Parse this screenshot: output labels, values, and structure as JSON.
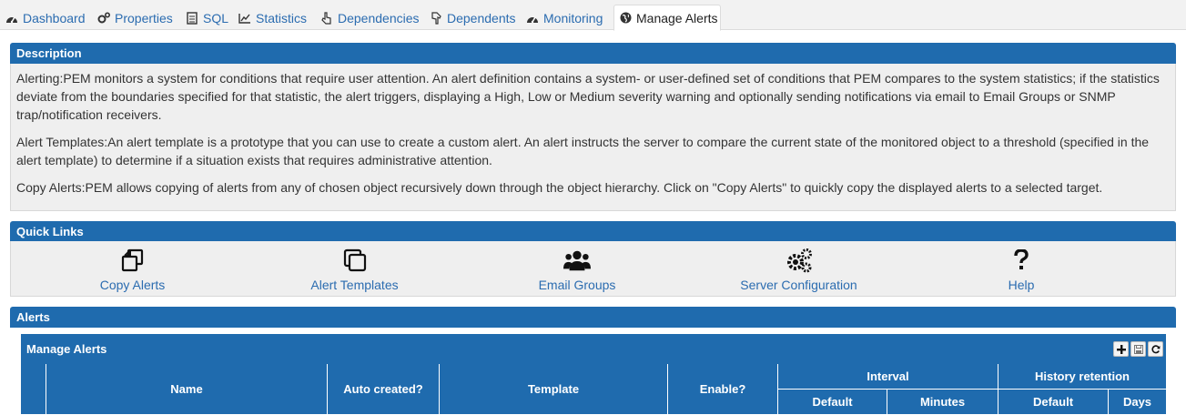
{
  "tabs": [
    {
      "label": "Dashboard",
      "icon": "dashboard-icon"
    },
    {
      "label": "Properties",
      "icon": "gears-icon"
    },
    {
      "label": "SQL",
      "icon": "file-icon"
    },
    {
      "label": "Statistics",
      "icon": "line-chart-icon"
    },
    {
      "label": "Dependencies",
      "icon": "hand-pointer-icon"
    },
    {
      "label": "Dependents",
      "icon": "hand-icon"
    },
    {
      "label": "Monitoring",
      "icon": "dashboard-icon"
    },
    {
      "label": "Manage Alerts",
      "icon": "globe-icon",
      "active": true
    }
  ],
  "description": {
    "title": "Description",
    "paragraphs": [
      "Alerting:PEM monitors a system for conditions that require user attention. An alert definition contains a system- or user-defined set of conditions that PEM compares to the system statistics; if the statistics deviate from the boundaries specified for that statistic, the alert triggers, displaying a High, Low or Medium severity warning and optionally sending notifications via email to Email Groups or SNMP trap/notification receivers.",
      "Alert Templates:An alert template is a prototype that you can use to create a custom alert. An alert instructs the server to compare the current state of the monitored object to a threshold (specified in the alert template) to determine if a situation exists that requires administrative attention.",
      "Copy Alerts:PEM allows copying of alerts from any of chosen object recursively down through the object hierarchy. Click on \"Copy Alerts\" to quickly copy the displayed alerts to a selected target."
    ]
  },
  "quick_links": {
    "title": "Quick Links",
    "items": [
      {
        "label": "Copy Alerts",
        "icon": "copy-icon"
      },
      {
        "label": "Alert Templates",
        "icon": "clone-icon"
      },
      {
        "label": "Email Groups",
        "icon": "users-icon"
      },
      {
        "label": "Server Configuration",
        "icon": "gears-icon"
      },
      {
        "label": "Help",
        "icon": "question-icon"
      }
    ]
  },
  "alerts": {
    "title": "Alerts",
    "panel_title": "Manage Alerts",
    "tools": [
      "add-icon",
      "save-icon",
      "refresh-icon"
    ],
    "columns": {
      "name": "Name",
      "auto_created": "Auto created?",
      "template": "Template",
      "enable": "Enable?",
      "interval": "Interval",
      "interval_default": "Default",
      "interval_minutes": "Minutes",
      "history": "History retention",
      "history_default": "Default",
      "history_days": "Days"
    }
  },
  "colors": {
    "header_blue": "#1f6bae",
    "link_blue": "#2b6cb0",
    "panel_bg": "#efefef"
  }
}
